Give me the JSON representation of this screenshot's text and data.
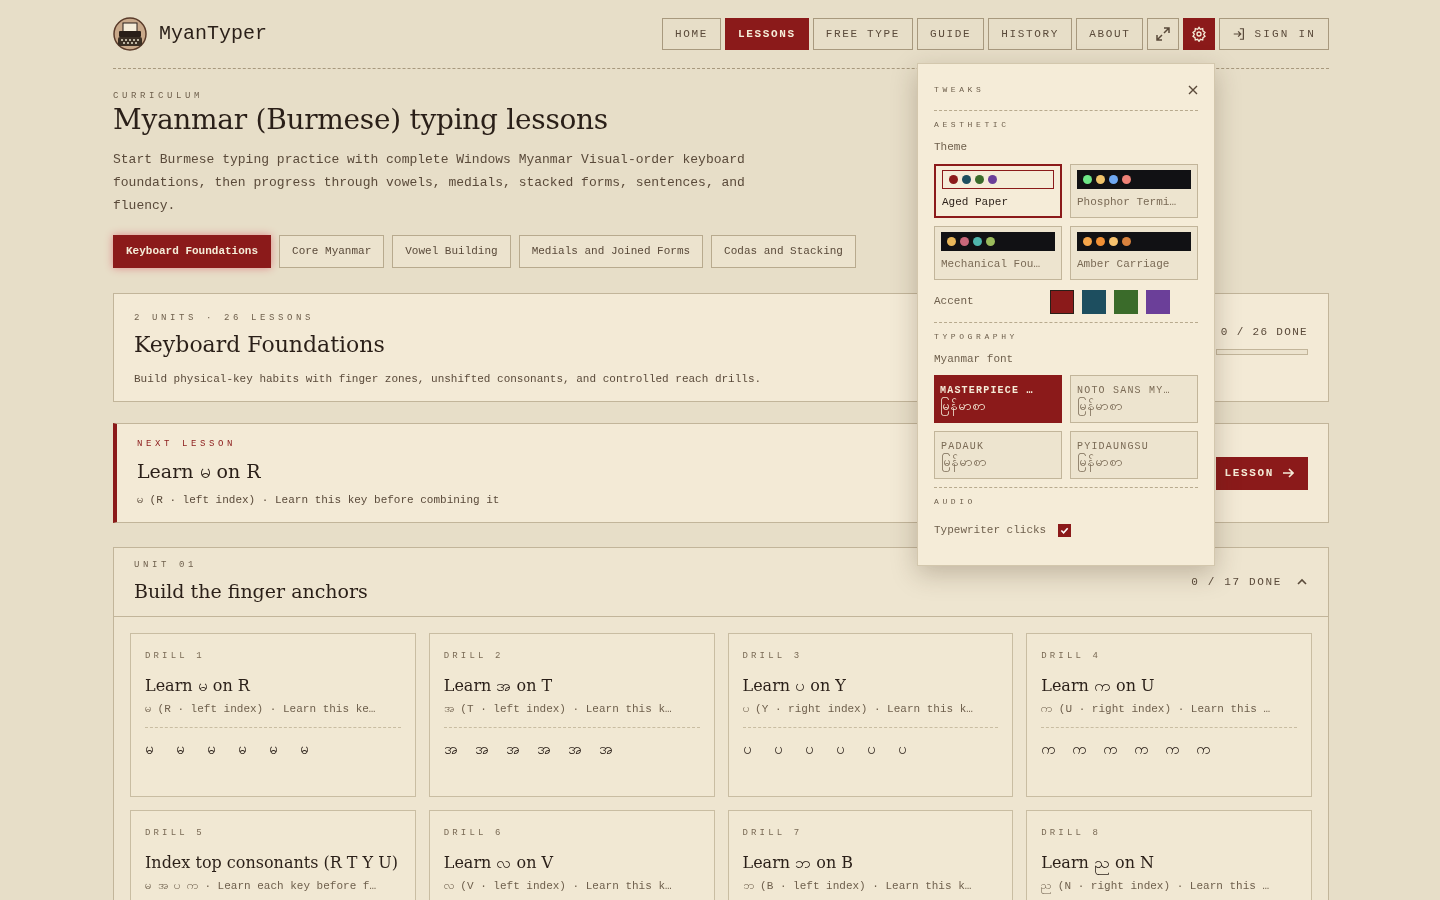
{
  "brand": {
    "name": "MyanTyper"
  },
  "nav": [
    {
      "label": "HOME",
      "selected": false
    },
    {
      "label": "LESSONS",
      "selected": true
    },
    {
      "label": "FREE TYPE",
      "selected": false
    },
    {
      "label": "GUIDE",
      "selected": false
    },
    {
      "label": "HISTORY",
      "selected": false
    },
    {
      "label": "ABOUT",
      "selected": false
    }
  ],
  "tools": [
    {
      "kind": "expand",
      "selected": false
    },
    {
      "kind": "settings",
      "selected": true
    }
  ],
  "sign_in": "SIGN IN",
  "header": {
    "eyebrow": "CURRICULUM",
    "title": "Myanmar (Burmese) typing lessons",
    "description": "Start Burmese typing practice with complete Windows Myanmar Visual-order keyboard foundations, then progress through vowels, medials, stacked forms, sentences, and fluency."
  },
  "tracks": [
    {
      "label": "Keyboard Foundations",
      "selected": true
    },
    {
      "label": "Core Myanmar",
      "selected": false
    },
    {
      "label": "Vowel Building",
      "selected": false
    },
    {
      "label": "Medials and Joined Forms",
      "selected": false
    },
    {
      "label": "Codas and Stacking",
      "selected": false
    }
  ],
  "track_card": {
    "meta": "2 UNITS · 26 LESSONS",
    "title": "Keyboard Foundations",
    "description": "Build physical-key habits with finger zones, unshifted consonants, and controlled reach drills.",
    "progress": "0 / 26 DONE",
    "level": 0
  },
  "next_lesson": {
    "eyebrow": "NEXT LESSON",
    "title": "Learn မ on R",
    "detail": "မ (R · left index) · Learn this key before combining it",
    "button": "LESSON"
  },
  "unit": {
    "eyebrow": "UNIT 01",
    "title": "Build the finger anchors",
    "progress": "0 / 17 DONE",
    "expanded": true,
    "drills": [
      {
        "label": "DRILL 1",
        "title": "Learn မ on R",
        "detail": "မ (R · left index) · Learn this ke…",
        "keys": [
          "မ",
          "မ",
          "မ",
          "မ",
          "မ",
          "မ"
        ]
      },
      {
        "label": "DRILL 2",
        "title": "Learn အ on T",
        "detail": "အ (T · left index) · Learn this k…",
        "keys": [
          "အ",
          "အ",
          "အ",
          "အ",
          "အ",
          "အ"
        ]
      },
      {
        "label": "DRILL 3",
        "title": "Learn ပ on Y",
        "detail": "ပ (Y · right index) · Learn this k…",
        "keys": [
          "ပ",
          "ပ",
          "ပ",
          "ပ",
          "ပ",
          "ပ"
        ]
      },
      {
        "label": "DRILL 4",
        "title": "Learn က on U",
        "detail": "က (U · right index) · Learn this …",
        "keys": [
          "က",
          "က",
          "က",
          "က",
          "က",
          "က"
        ]
      },
      {
        "label": "DRILL 5",
        "title": "Index top consonants (R T Y U)",
        "detail": "မ အ ပ က · Learn each key before f…"
      },
      {
        "label": "DRILL 6",
        "title": "Learn လ on V",
        "detail": "လ (V · left index) · Learn this k…"
      },
      {
        "label": "DRILL 7",
        "title": "Learn ဘ on B",
        "detail": "ဘ (B · left index) · Learn this k…"
      },
      {
        "label": "DRILL 8",
        "title": "Learn ည on N",
        "detail": "ည (N · right index) · Learn this …"
      }
    ]
  },
  "tweaks": {
    "title": "TWEAKS",
    "aesthetic": {
      "heading": "AESTHETIC",
      "theme_label": "Theme",
      "themes": [
        {
          "name": "Aged Paper",
          "dark": false,
          "selected": true,
          "dots": [
            {
              "color": "#8b1a1a"
            },
            {
              "color": "#1d4e5f"
            },
            {
              "color": "#3a6b2a"
            },
            {
              "color": "#6b3f99"
            }
          ]
        },
        {
          "name": "Phosphor Termi…",
          "dark": true,
          "selected": false,
          "dots": [
            {
              "color": "#6ee787"
            },
            {
              "color": "#f0c36a"
            },
            {
              "color": "#6fa8f2"
            },
            {
              "color": "#ef8277"
            }
          ]
        },
        {
          "name": "Mechanical Fou…",
          "dark": true,
          "selected": false,
          "dots": [
            {
              "color": "#e8b65a"
            },
            {
              "color": "#c9677a"
            },
            {
              "color": "#4fb6ad"
            },
            {
              "color": "#9bbb5c"
            }
          ]
        },
        {
          "name": "Amber Carriage",
          "dark": true,
          "selected": false,
          "dots": [
            {
              "color": "#f5a54a"
            },
            {
              "color": "#f19035"
            },
            {
              "color": "#f7c26e"
            },
            {
              "color": "#d9823e"
            }
          ]
        }
      ],
      "accent_label": "Accent",
      "accents": [
        {
          "color": "#8b1a1a",
          "selected": true
        },
        {
          "color": "#1d4e5f",
          "selected": false
        },
        {
          "color": "#3a6b2a",
          "selected": false
        },
        {
          "color": "#6b3f99",
          "selected": false
        }
      ]
    },
    "typography": {
      "heading": "TYPOGRAPHY",
      "font_label": "Myanmar font",
      "fonts": [
        {
          "name": "MASTERPIECE …",
          "sample": "မြန်မာစာ",
          "selected": true
        },
        {
          "name": "NOTO SANS MY…",
          "sample": "မြန်မာစာ",
          "selected": false
        },
        {
          "name": "PADAUK",
          "sample": "မြန်မာစာ",
          "selected": false
        },
        {
          "name": "PYIDAUNGSU",
          "sample": "မြန်မာစာ",
          "selected": false
        }
      ]
    },
    "audio": {
      "heading": "AUDIO",
      "label": "Typewriter clicks",
      "checked": true
    }
  }
}
